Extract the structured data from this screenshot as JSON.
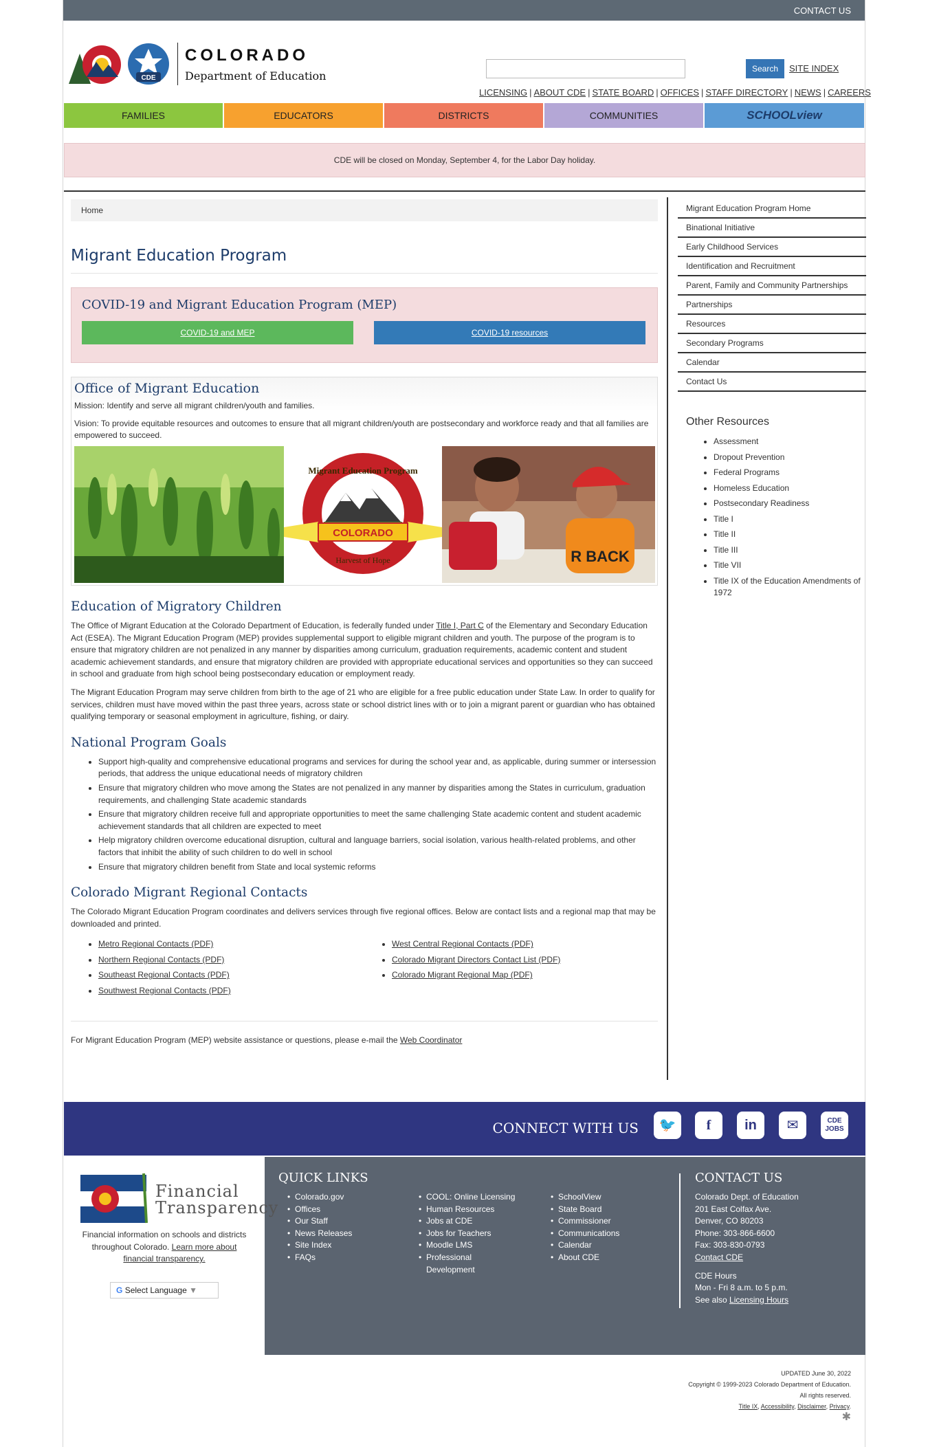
{
  "topbar": {
    "contact_us": "CONTACT US"
  },
  "header": {
    "logo_title": "COLORADO",
    "logo_subtitle": "Department of Education",
    "logo_badge": "CDE",
    "search_placeholder": "",
    "search_button": "Search",
    "site_index": "SITE INDEX",
    "links": [
      "LICENSING",
      "ABOUT CDE",
      "STATE BOARD",
      "OFFICES",
      "STAFF DIRECTORY",
      "NEWS",
      "CAREERS"
    ]
  },
  "nav": {
    "tabs": [
      {
        "label": "FAMILIES",
        "color": "#8cc63f"
      },
      {
        "label": "EDUCATORS",
        "color": "#f7a12f"
      },
      {
        "label": "DISTRICTS",
        "color": "#ef7a5e"
      },
      {
        "label": "COMMUNITIES",
        "color": "#b4a7d6"
      },
      {
        "label": "SCHOOLview",
        "color": "#5b9bd5"
      }
    ]
  },
  "alert": {
    "text": "CDE will be closed on Monday, September 4, for the Labor Day holiday."
  },
  "breadcrumb": {
    "home": "Home"
  },
  "page": {
    "title": "Migrant Education Program"
  },
  "covid": {
    "heading": "COVID-19 and Migrant Education Program (MEP)",
    "btn1": "COVID-19 and MEP",
    "btn1_color": "#5cb85c",
    "btn2": "COVID-19 resources",
    "btn2_color": "#337ab7"
  },
  "office": {
    "heading": "Office of Migrant Education",
    "mission_label": "Mission:",
    "mission": " Identify and serve all migrant children/youth and families.",
    "vision_label": "Vision:",
    "vision": " To provide equitable resources and outcomes to ensure that all migrant children/youth are postsecondary and workforce ready and that all families are empowered to succeed.",
    "seal_top": "Migrant Education Program",
    "seal_banner": "COLORADO",
    "seal_bottom": "Harvest of Hope",
    "kid_shirt": "R BACK"
  },
  "education": {
    "heading": "Education of Migratory Children",
    "p1_a": "The Office of Migrant Education at the Colorado Department of Education, is federally funded under ",
    "p1_link": "Title I, Part C",
    "p1_b": " of the Elementary and Secondary Education Act (ESEA). The Migrant Education Program (MEP) provides supplemental support to eligible migrant children and youth. The purpose of the program is to ensure that migratory children are not penalized in any manner by disparities among curriculum, graduation requirements, academic content and student academic achievement standards, and ensure that migratory children are provided with appropriate educational services and opportunities so they can succeed in school and graduate from high school being postsecondary education or employment ready.",
    "p2": "The Migrant Education Program may serve children from birth to the age of 21 who are eligible for a free public education under State Law. In order to qualify for services, children must have moved within the past three years, across state or school district lines with or to join a migrant parent or guardian who has obtained qualifying temporary or seasonal employment in agriculture, fishing, or dairy."
  },
  "goals": {
    "heading": "National Program Goals",
    "items": [
      "Support high-quality and comprehensive educational programs and services for during the school year and, as applicable, during summer or intersession periods, that address the unique educational needs of migratory children",
      "Ensure that migratory children who move among the States are not penalized in any manner by disparities among the States in curriculum, graduation requirements, and challenging State academic standards",
      "Ensure that migratory children receive full and appropriate opportunities to meet the same challenging State academic content and student academic achievement standards that all children are expected to meet",
      "Help migratory children overcome educational disruption, cultural and language barriers, social isolation, various health-related problems, and other factors that inhibit the ability of such children to do well in school",
      "Ensure that migratory children benefit from State and local systemic reforms"
    ]
  },
  "regional": {
    "heading": "Colorado Migrant Regional Contacts",
    "intro": "The Colorado Migrant Education Program coordinates and delivers services through five regional offices. Below are contact lists and a regional map that may be downloaded and printed.",
    "left": [
      "Metro Regional Contacts (PDF)",
      "Northern Regional Contacts (PDF)",
      "Southeast Regional Contacts (PDF)",
      "Southwest Regional Contacts (PDF)"
    ],
    "right": [
      "West Central Regional Contacts (PDF)",
      "Colorado Migrant Directors Contact List (PDF)",
      "Colorado Migrant Regional Map (PDF)"
    ]
  },
  "footnote": {
    "text": "For Migrant Education Program (MEP) website assistance or questions, please e-mail the ",
    "link": "Web Coordinator"
  },
  "sidebar": {
    "items": [
      "Migrant Education Program Home",
      "Binational Initiative",
      "Early Childhood Services",
      "Identification and Recruitment",
      "Parent, Family and Community Partnerships",
      "Partnerships",
      "Resources",
      "Secondary Programs",
      "Calendar",
      "Contact Us"
    ],
    "other_heading": "Other Resources",
    "other": [
      "Assessment",
      "Dropout Prevention",
      "Federal Programs",
      "Homeless Education",
      "Postsecondary Readiness",
      "Title I",
      "Title II",
      "Title III",
      "Title VII",
      "Title IX of the Education Amendments of 1972"
    ]
  },
  "connect": {
    "label": "CONNECT WITH US",
    "jobs": "CDE JOBS"
  },
  "footer": {
    "ft_line1": "Financial",
    "ft_line2": "Transparency",
    "ft_desc": "Financial information on schools and districts throughout Colorado. ",
    "ft_link": "Learn more about financial transparency.",
    "lang": "Select Language",
    "quick_heading": "QUICK LINKS",
    "col1": [
      "Colorado.gov",
      "Offices",
      "Our Staff",
      "News Releases",
      "Site Index",
      "FAQs"
    ],
    "col2": [
      "COOL: Online Licensing",
      "Human Resources",
      "Jobs at CDE",
      "Jobs for Teachers",
      "Moodle LMS",
      "Professional Development"
    ],
    "col3": [
      "SchoolView",
      "State Board",
      "Commissioner",
      "Communications",
      "Calendar",
      "About CDE"
    ],
    "contact_heading": "CONTACT US",
    "contact_lines": [
      "Colorado Dept. of Education",
      "201 East Colfax Ave.",
      "Denver, CO 80203",
      "Phone: 303-866-6600",
      "Fax: 303-830-0793"
    ],
    "contact_link": "Contact CDE",
    "hours_title": "CDE Hours",
    "hours": "Mon - Fri 8 a.m. to 5 p.m.",
    "see_also": "See also ",
    "licensing_hours": "Licensing Hours"
  },
  "bottom": {
    "updated": "UPDATED June 30, 2022",
    "copyright": "Copyright © 1999-2023 Colorado Department of Education.",
    "rights": "All rights reserved.",
    "links": [
      "Title IX",
      "Accessibility",
      "Disclaimer",
      "Privacy"
    ]
  }
}
